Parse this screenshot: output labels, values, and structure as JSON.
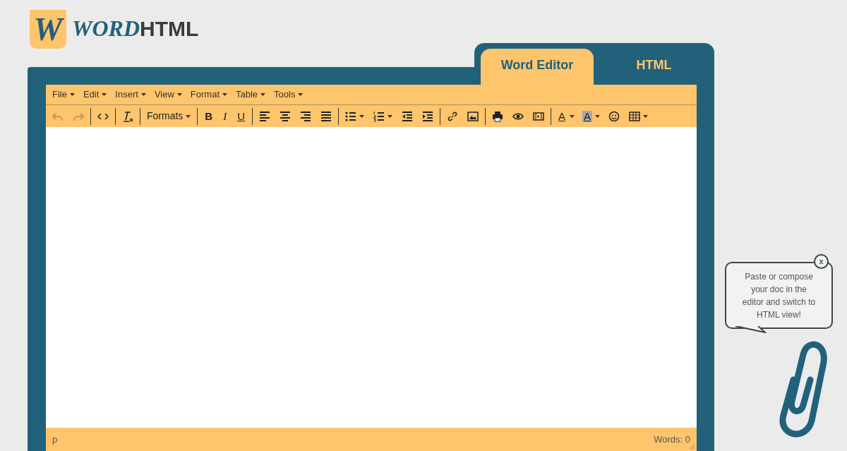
{
  "logo": {
    "badge": "W",
    "word": "WORD",
    "html": "HTML"
  },
  "tabs": [
    {
      "label": "Word Editor",
      "selected": true
    },
    {
      "label": "HTML",
      "selected": false
    }
  ],
  "menubar": [
    "File",
    "Edit",
    "Insert",
    "View",
    "Format",
    "Table",
    "Tools"
  ],
  "toolbar": [
    [
      {
        "kind": "icon",
        "disabled": true
      },
      {
        "kind": "icon",
        "disabled": true
      }
    ],
    [
      {
        "kind": "icon",
        "disabled": false
      }
    ],
    [
      {
        "kind": "icon",
        "disabled": false
      }
    ],
    [
      {
        "kind": "menu",
        "label": "Formats",
        "disabled": false
      }
    ],
    [
      {
        "kind": "glyph",
        "label": "B",
        "disabled": false
      },
      {
        "kind": "glyph",
        "label": "I",
        "disabled": false
      },
      {
        "kind": "glyph",
        "label": "U",
        "disabled": false
      }
    ],
    [
      {
        "kind": "icon",
        "disabled": false
      },
      {
        "kind": "icon",
        "disabled": false
      },
      {
        "kind": "icon",
        "disabled": false
      },
      {
        "kind": "icon",
        "disabled": false
      }
    ],
    [
      {
        "kind": "split",
        "disabled": false
      },
      {
        "kind": "split",
        "disabled": false
      },
      {
        "kind": "icon",
        "disabled": false
      },
      {
        "kind": "icon",
        "disabled": false
      }
    ],
    [
      {
        "kind": "icon",
        "disabled": false
      },
      {
        "kind": "icon",
        "disabled": false
      }
    ],
    [
      {
        "kind": "icon",
        "disabled": false
      },
      {
        "kind": "icon",
        "disabled": false
      },
      {
        "kind": "icon",
        "disabled": false
      }
    ],
    [
      {
        "kind": "glyph-split",
        "label": "A",
        "disabled": false
      },
      {
        "kind": "glyph-split",
        "label": "A",
        "disabled": false
      },
      {
        "kind": "icon",
        "disabled": false
      },
      {
        "kind": "split",
        "disabled": false
      }
    ]
  ],
  "status_bar": {
    "path": "p",
    "word_count": "Words: 0"
  },
  "assistant": {
    "message": "Paste or compose your doc in the editor and switch to HTML view!",
    "close": "x"
  }
}
